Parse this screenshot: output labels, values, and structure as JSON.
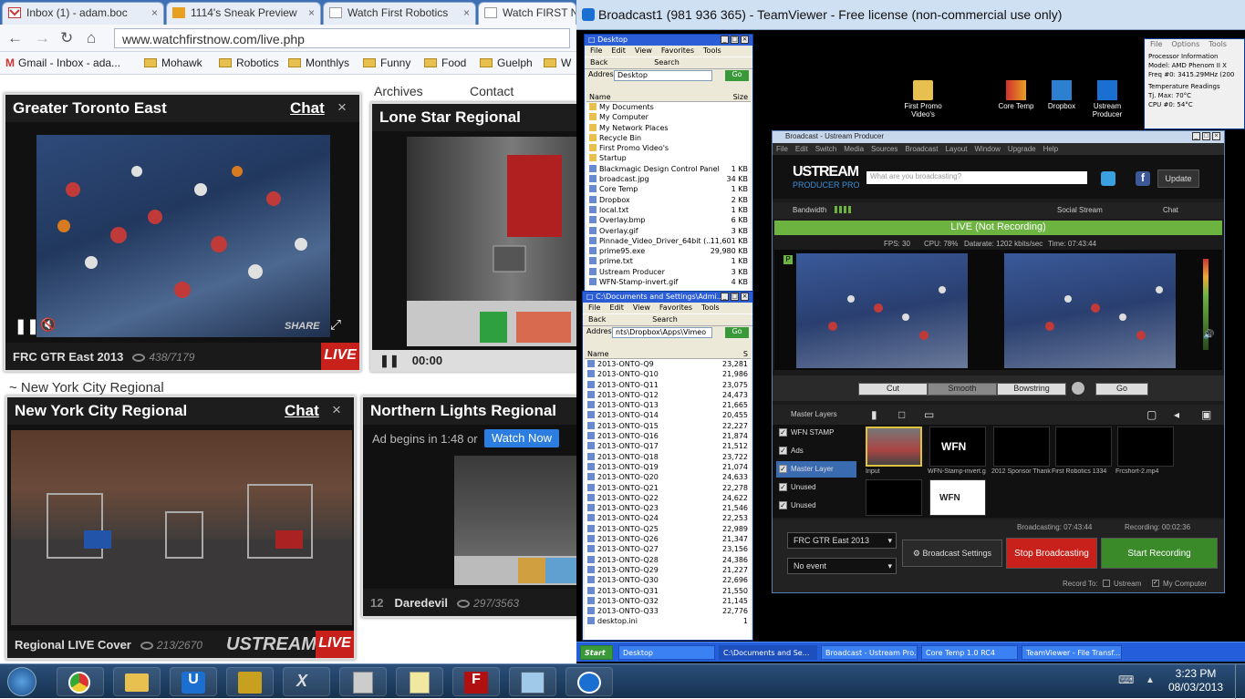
{
  "browser": {
    "tabs": [
      {
        "label": "Inbox (1) - adam.boc",
        "icon": "gmail-icon"
      },
      {
        "label": "1114's Sneak Preview",
        "icon": "team-icon"
      },
      {
        "label": "Watch First Robotics",
        "icon": "page-icon"
      },
      {
        "label": "Watch FIRST N",
        "icon": "page-icon"
      }
    ],
    "url": "www.watchfirstnow.com/live.php",
    "bookmarks": [
      {
        "label": "Gmail - Inbox - ada...",
        "icon": "gmail-icon"
      },
      {
        "label": "Mohawk",
        "icon": "folder-icon"
      },
      {
        "label": "Robotics",
        "icon": "folder-icon"
      },
      {
        "label": "Monthlys",
        "icon": "folder-icon"
      },
      {
        "label": "Funny",
        "icon": "folder-icon"
      },
      {
        "label": "Food",
        "icon": "folder-icon"
      },
      {
        "label": "Guelph",
        "icon": "folder-icon"
      },
      {
        "label": "W",
        "icon": "folder-icon"
      }
    ]
  },
  "site": {
    "nav": [
      "Archives",
      "Contact"
    ],
    "section_label": "~ New York City Regional",
    "streams": [
      {
        "title": "Greater Toronto East",
        "chat": "Chat",
        "close": "×",
        "footer": "FRC GTR East 2013",
        "views": "438/7179",
        "live": "LIVE",
        "share": "SHARE"
      },
      {
        "title": "Lone Star Regional",
        "time": "00:00"
      },
      {
        "title": "New York City Regional",
        "chat": "Chat",
        "close": "×",
        "footer": "Regional LIVE Cover",
        "views": "213/2670",
        "brand": "USTREAM",
        "live": "LIVE"
      },
      {
        "title": "Northern Lights Regional",
        "ad_text": "Ad begins in 1:48 or",
        "watch_now": "Watch Now",
        "footer_num": "12",
        "footer": "Daredevil",
        "views": "297/3563"
      }
    ]
  },
  "teamviewer": {
    "title": "Broadcast1 (981 936 365) - TeamViewer - Free license (non-commercial use only)",
    "desktop_icons": [
      {
        "label": "First Promo Video's"
      },
      {
        "label": "Core Temp"
      },
      {
        "label": "Dropbox"
      },
      {
        "label": "Ustream Producer"
      }
    ],
    "coretemp": {
      "menu": [
        "File",
        "Options",
        "Tools"
      ],
      "processor_info": "Processor Information",
      "model_label": "Model:",
      "model": "AMD Phenom II X",
      "freq_label": "Freq #0:",
      "freq": "3415.29MHz (200",
      "temp_readings": "Temperature Readings",
      "tj_label": "Tj. Max:",
      "tj": "70°C",
      "cpu_label": "CPU #0:",
      "cpu": "54°C"
    },
    "explorer1": {
      "title": "Desktop",
      "menu": [
        "File",
        "Edit",
        "View",
        "Favorites",
        "Tools"
      ],
      "back": "Back",
      "search": "Search",
      "address_label": "Address",
      "address": "Desktop",
      "go": "Go",
      "col_name": "Name",
      "col_size": "Size",
      "files": [
        {
          "name": "My Documents",
          "size": ""
        },
        {
          "name": "My Computer",
          "size": ""
        },
        {
          "name": "My Network Places",
          "size": ""
        },
        {
          "name": "Recycle Bin",
          "size": ""
        },
        {
          "name": "First Promo Video's",
          "size": ""
        },
        {
          "name": "Startup",
          "size": ""
        },
        {
          "name": "Blackmagic Design Control Panel",
          "size": "1 KB"
        },
        {
          "name": "broadcast.jpg",
          "size": "34 KB"
        },
        {
          "name": "Core Temp",
          "size": "1 KB"
        },
        {
          "name": "Dropbox",
          "size": "2 KB"
        },
        {
          "name": "local.txt",
          "size": "1 KB"
        },
        {
          "name": "Overlay.bmp",
          "size": "6 KB"
        },
        {
          "name": "Overlay.gif",
          "size": "3 KB"
        },
        {
          "name": "Pinnade_Video_Driver_64bit (...",
          "size": "11,601 KB"
        },
        {
          "name": "prime95.exe",
          "size": "29,980 KB"
        },
        {
          "name": "prime.txt",
          "size": "1 KB"
        },
        {
          "name": "Ustream Producer",
          "size": "3 KB"
        },
        {
          "name": "WFN-Stamp-invert.gif",
          "size": "4 KB"
        }
      ]
    },
    "explorer2": {
      "title": "C:\\Documents and Settings\\Admi...",
      "menu": [
        "File",
        "Edit",
        "View",
        "Favorites",
        "Tools"
      ],
      "back": "Back",
      "search": "Search",
      "address_label": "Address",
      "address": "nts\\Dropbox\\Apps\\Vimeo",
      "go": "Go",
      "col_name": "Name",
      "col_size": "S",
      "files": [
        {
          "name": "2013-ONTO-Q9",
          "size": "23,281"
        },
        {
          "name": "2013-ONTO-Q10",
          "size": "21,986"
        },
        {
          "name": "2013-ONTO-Q11",
          "size": "23,075"
        },
        {
          "name": "2013-ONTO-Q12",
          "size": "24,473"
        },
        {
          "name": "2013-ONTO-Q13",
          "size": "21,665"
        },
        {
          "name": "2013-ONTO-Q14",
          "size": "20,455"
        },
        {
          "name": "2013-ONTO-Q15",
          "size": "22,227"
        },
        {
          "name": "2013-ONTO-Q16",
          "size": "21,874"
        },
        {
          "name": "2013-ONTO-Q17",
          "size": "21,512"
        },
        {
          "name": "2013-ONTO-Q18",
          "size": "23,722"
        },
        {
          "name": "2013-ONTO-Q19",
          "size": "21,074"
        },
        {
          "name": "2013-ONTO-Q20",
          "size": "24,633"
        },
        {
          "name": "2013-ONTO-Q21",
          "size": "22,278"
        },
        {
          "name": "2013-ONTO-Q22",
          "size": "24,622"
        },
        {
          "name": "2013-ONTO-Q23",
          "size": "21,546"
        },
        {
          "name": "2013-ONTO-Q24",
          "size": "22,253"
        },
        {
          "name": "2013-ONTO-Q25",
          "size": "22,989"
        },
        {
          "name": "2013-ONTO-Q26",
          "size": "21,347"
        },
        {
          "name": "2013-ONTO-Q27",
          "size": "23,156"
        },
        {
          "name": "2013-ONTO-Q28",
          "size": "24,386"
        },
        {
          "name": "2013-ONTO-Q29",
          "size": "21,227"
        },
        {
          "name": "2013-ONTO-Q30",
          "size": "22,696"
        },
        {
          "name": "2013-ONTO-Q31",
          "size": "21,550"
        },
        {
          "name": "2013-ONTO-Q32",
          "size": "21,145"
        },
        {
          "name": "2013-ONTO-Q33",
          "size": "22,776"
        },
        {
          "name": "desktop.ini",
          "size": "1"
        }
      ]
    },
    "ustream": {
      "title": "Broadcast - Ustream Producer",
      "menu": [
        "File",
        "Edit",
        "Switch",
        "Media",
        "Sources",
        "Broadcast",
        "Layout",
        "Window",
        "Upgrade",
        "Help"
      ],
      "logo_top": "USTREAM",
      "logo_bottom": "PRODUCER PRO",
      "status_placeholder": "What are you broadcasting?",
      "update": "Update",
      "bandwidth": "Bandwidth",
      "social_stream": "Social Stream",
      "chat": "Chat",
      "live_status": "LIVE (Not Recording)",
      "fps": "FPS: 30",
      "cpu": "CPU: 78%",
      "datarate": "Datarate: 1202 kbits/sec",
      "time": "Time: 07:43:44",
      "transitions": [
        "Cut",
        "Smooth",
        "Bowstring"
      ],
      "go": "Go",
      "master_layers": "Master Layers",
      "layers": [
        "WFN STAMP",
        "Ads",
        "Master Layer",
        "Unused",
        "Unused"
      ],
      "thumbs": [
        "Input",
        "WFN-Stamp-invert.g",
        "2012 Sponsor Thank",
        "First Robotics 1334",
        "Frcshort-2.mp4"
      ],
      "wfn": "WFN",
      "event_select": "FRC GTR East 2013",
      "no_event": "No event",
      "broadcast_settings": "Broadcast Settings",
      "stop": "Stop Broadcasting",
      "start_rec": "Start Recording",
      "broadcasting_time": "Broadcasting: 07:43:44",
      "recording_time": "Recording: 00:02:36",
      "record_to": "Record To:",
      "rec_ustream": "Ustream",
      "rec_computer": "My Computer"
    },
    "xp_taskbar": {
      "start": "Start",
      "items": [
        "Desktop",
        "C:\\Documents and Se...",
        "Broadcast - Ustream Pro...",
        "Core Temp 1.0 RC4",
        "TeamViewer - File Transf..."
      ]
    }
  },
  "win_taskbar": {
    "apps": [
      "start-orb-icon",
      "chrome-icon",
      "explorer-icon",
      "ustream-icon",
      "winamp-icon",
      "x5-icon",
      "calculator-icon",
      "notepad-icon",
      "filezilla-icon",
      "paint-icon",
      "teamviewer-icon"
    ],
    "time": "3:23 PM",
    "date": "08/03/2013"
  },
  "colors": {
    "tab_bar": "#3c6fb4",
    "live_red": "#c8201a",
    "ustream_green": "#6cb33f",
    "stop_red": "#c8201a",
    "start_green": "#3a8a2a",
    "watch_now_blue": "#2b7de0"
  }
}
